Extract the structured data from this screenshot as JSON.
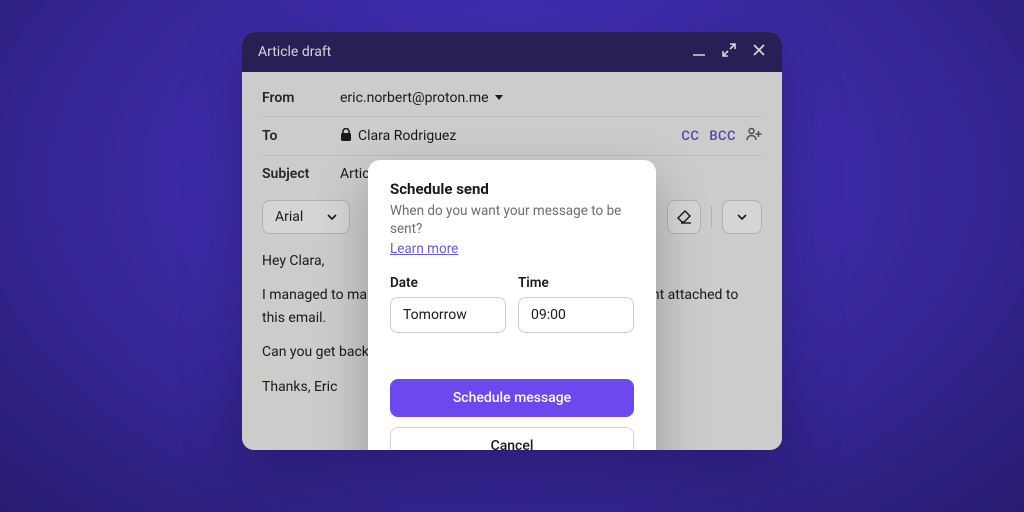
{
  "window": {
    "title": "Article draft"
  },
  "compose": {
    "from_label": "From",
    "from_value": "eric.norbert@proton.me",
    "to_label": "To",
    "to_value": "Clara Rodriguez",
    "cc_label": "CC",
    "bcc_label": "BCC",
    "subject_label": "Subject",
    "subject_value": "Article",
    "font_name": "Arial",
    "body": {
      "p1": "Hey Clara,",
      "p2": "I managed to make corrections to the article draft, see document attached to this email.",
      "p3": "Can you get back to",
      "p4": "Thanks, Eric"
    }
  },
  "modal": {
    "title": "Schedule send",
    "hint": "When do you want your message to be sent?",
    "learn_more": "Learn more",
    "date_label": "Date",
    "date_value": "Tomorrow",
    "time_label": "Time",
    "time_value": "09:00",
    "primary": "Schedule message",
    "secondary": "Cancel"
  }
}
